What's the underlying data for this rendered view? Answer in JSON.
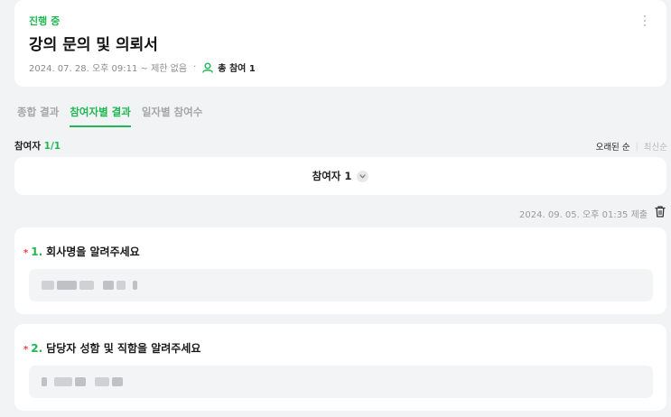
{
  "survey": {
    "status": "진행 중",
    "title": "강의 문의 및 의뢰서",
    "period": "2024. 07. 28. 오후 09:11 ~ 제한 없음",
    "separator": "·",
    "participants": "총 참여 1"
  },
  "tabs": [
    {
      "label": "종합 결과",
      "active": false
    },
    {
      "label": "참여자별 결과",
      "active": true
    },
    {
      "label": "일자별 참여수",
      "active": false
    }
  ],
  "participant_count": {
    "label": "참여자",
    "value": "1/1"
  },
  "sort": {
    "oldest": "오래된 순",
    "newest": "최신순"
  },
  "selector": {
    "label": "참여자 1"
  },
  "submission": {
    "timestamp": "2024. 09. 05. 오후 01:35 제출"
  },
  "questions": [
    {
      "required_mark": "*",
      "number": "1.",
      "text": "회사명을 알려주세요"
    },
    {
      "required_mark": "*",
      "number": "2.",
      "text": "담당자 성함 및 직함을 알려주세요"
    }
  ],
  "colors": {
    "accent": "#1fb853",
    "required": "#ff3b3b",
    "background": "#f2f3f5"
  }
}
